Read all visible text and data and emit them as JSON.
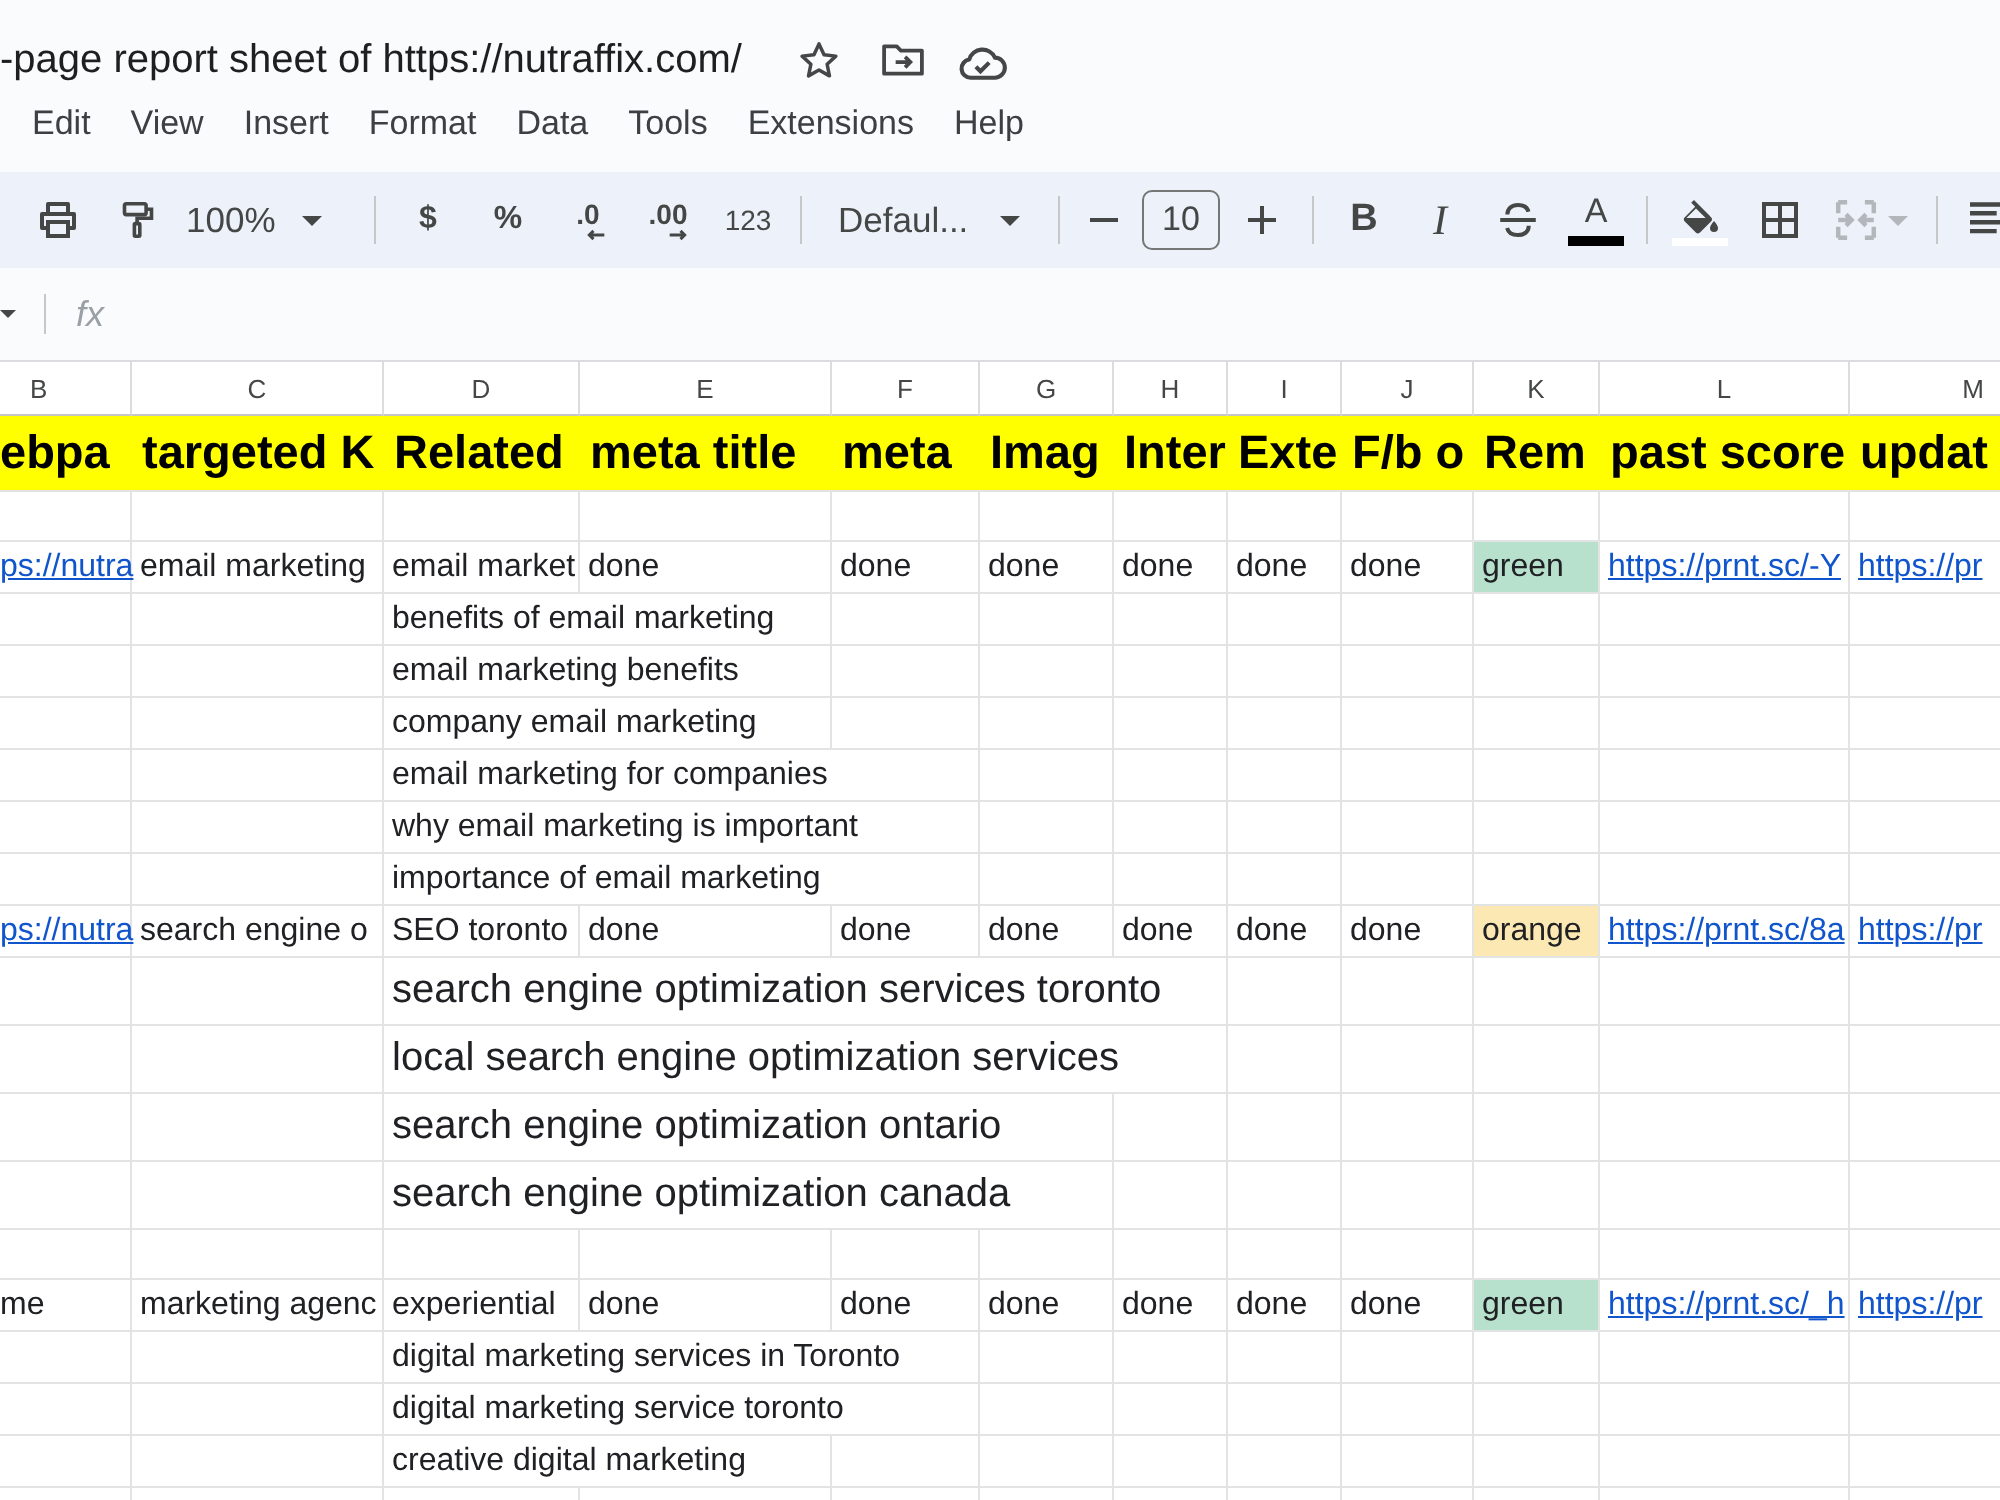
{
  "document": {
    "title": "-page report sheet of https://nutraffix.com/"
  },
  "menu": [
    "Edit",
    "View",
    "Insert",
    "Format",
    "Data",
    "Tools",
    "Extensions",
    "Help"
  ],
  "toolbar": {
    "zoom": "100%",
    "currency": "$",
    "percent": "%",
    "decrease_decimals": ".0",
    "increase_decimals": ".00",
    "number_format": "123",
    "font": "Defaul...",
    "font_size": "10",
    "bold": "B",
    "italic": "I",
    "text_color": "A",
    "merge": {
      "disabled": true
    }
  },
  "formula_bar": {
    "label": "fx"
  },
  "columns": [
    "B",
    "C",
    "D",
    "E",
    "F",
    "G",
    "H",
    "I",
    "J",
    "K",
    "L",
    "M"
  ],
  "rows": [
    {
      "kind": "header",
      "cells": [
        "ebpa",
        "targeted K",
        "Related",
        "meta title",
        "meta",
        "Imag",
        "Inter",
        "Exte",
        "F/b o",
        "Rem",
        "past score",
        "updat"
      ]
    },
    {
      "kind": "blank"
    },
    {
      "kind": "record",
      "cells": [
        {
          "text": "ps://nutra",
          "link": true
        },
        {
          "text": "email marketing",
          "link": false
        },
        {
          "text": "email market",
          "link": false
        },
        {
          "text": "done",
          "link": false
        },
        {
          "text": "done",
          "link": false
        },
        {
          "text": "done",
          "link": false
        },
        {
          "text": "done",
          "link": false
        },
        {
          "text": "done",
          "link": false
        },
        {
          "text": "done",
          "link": false
        },
        {
          "text": "green",
          "link": false,
          "color": "#b7e1cd"
        },
        {
          "text": "https://prnt.sc/-Y",
          "link": true
        },
        {
          "text": "https://pr",
          "link": true
        }
      ]
    },
    {
      "kind": "keyword",
      "text": "benefits of email marketing"
    },
    {
      "kind": "keyword",
      "text": "email marketing benefits"
    },
    {
      "kind": "keyword",
      "text": "company email marketing"
    },
    {
      "kind": "keyword",
      "text": "email marketing for companies"
    },
    {
      "kind": "keyword",
      "text": "why email marketing is important"
    },
    {
      "kind": "keyword",
      "text": "importance of email marketing"
    },
    {
      "kind": "record",
      "cells": [
        {
          "text": "ps://nutra",
          "link": true
        },
        {
          "text": "search engine o",
          "link": false
        },
        {
          "text": "SEO toronto",
          "link": false
        },
        {
          "text": "done",
          "link": false
        },
        {
          "text": "done",
          "link": false
        },
        {
          "text": "done",
          "link": false
        },
        {
          "text": "done",
          "link": false
        },
        {
          "text": "done",
          "link": false
        },
        {
          "text": "done",
          "link": false
        },
        {
          "text": "orange",
          "link": false,
          "color": "#fce8b2"
        },
        {
          "text": "https://prnt.sc/8a",
          "link": true
        },
        {
          "text": "https://pr",
          "link": true
        }
      ]
    },
    {
      "kind": "pasted",
      "text": "search engine optimization services toronto"
    },
    {
      "kind": "pasted",
      "text": "local search engine optimization services"
    },
    {
      "kind": "pasted",
      "text": "search engine optimization ontario"
    },
    {
      "kind": "pasted",
      "text": "search engine optimization canada"
    },
    {
      "kind": "blank"
    },
    {
      "kind": "record",
      "cells": [
        {
          "text": "me",
          "link": false
        },
        {
          "text": "marketing agenc",
          "link": false
        },
        {
          "text": "experiential",
          "link": false
        },
        {
          "text": "done",
          "link": false
        },
        {
          "text": "done",
          "link": false
        },
        {
          "text": "done",
          "link": false
        },
        {
          "text": "done",
          "link": false
        },
        {
          "text": "done",
          "link": false
        },
        {
          "text": "done",
          "link": false
        },
        {
          "text": "green",
          "link": false,
          "color": "#b7e1cd"
        },
        {
          "text": "https://prnt.sc/_h",
          "link": true
        },
        {
          "text": "https://pr",
          "link": true
        }
      ]
    },
    {
      "kind": "keyword",
      "text": "digital marketing services in Toronto"
    },
    {
      "kind": "keyword",
      "text": "digital marketing service toronto"
    },
    {
      "kind": "keyword",
      "text": "creative digital marketing"
    }
  ]
}
